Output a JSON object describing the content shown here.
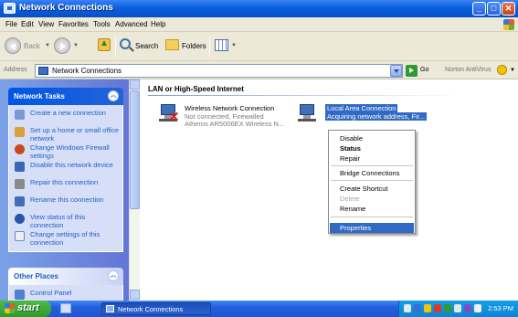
{
  "window": {
    "title": "Network Connections"
  },
  "menubar": [
    "File",
    "Edit",
    "View",
    "Favorites",
    "Tools",
    "Advanced",
    "Help"
  ],
  "toolbar": {
    "back": "Back",
    "search": "Search",
    "folders": "Folders"
  },
  "address": {
    "label": "Address",
    "value": "Network Connections",
    "go": "Go",
    "antivirus": "Norton AntiVirus"
  },
  "network_tasks": {
    "title": "Network Tasks",
    "items": [
      {
        "label": "Create a new connection",
        "icon": "new-connection-icon"
      },
      {
        "label": "Set up a home or small office network",
        "icon": "home-network-icon"
      },
      {
        "label": "Change Windows Firewall settings",
        "icon": "firewall-icon"
      },
      {
        "label": "Disable this network device",
        "icon": "disable-device-icon"
      },
      {
        "label": "Repair this connection",
        "icon": "repair-icon"
      },
      {
        "label": "Rename this connection",
        "icon": "rename-icon"
      },
      {
        "label": "View status of this connection",
        "icon": "status-icon"
      },
      {
        "label": "Change settings of this connection",
        "icon": "settings-icon"
      }
    ]
  },
  "other_places": {
    "title": "Other Places",
    "items": [
      {
        "label": "Control Panel",
        "icon": "control-panel-icon"
      }
    ]
  },
  "content": {
    "group_title": "LAN or High-Speed Internet",
    "wireless": {
      "name": "Wireless Network Connection",
      "status": "Not connected, Firewalled",
      "device": "Atheros AR5006EX Wireless N..."
    },
    "local": {
      "name": "Local Area Connection",
      "status": "Acquiring network address, Fir..."
    }
  },
  "context_menu": {
    "items": [
      "Disable",
      "Status",
      "Repair",
      "Bridge Connections",
      "Create Shortcut",
      "Delete",
      "Rename",
      "Properties"
    ]
  },
  "taskbar": {
    "start": "start",
    "task": "Network Connections",
    "clock": "2:53 PM"
  },
  "colors": {
    "selection": "#316ac5",
    "taskpane": "#7ba2e7",
    "titlebar": "#0a5fde"
  }
}
